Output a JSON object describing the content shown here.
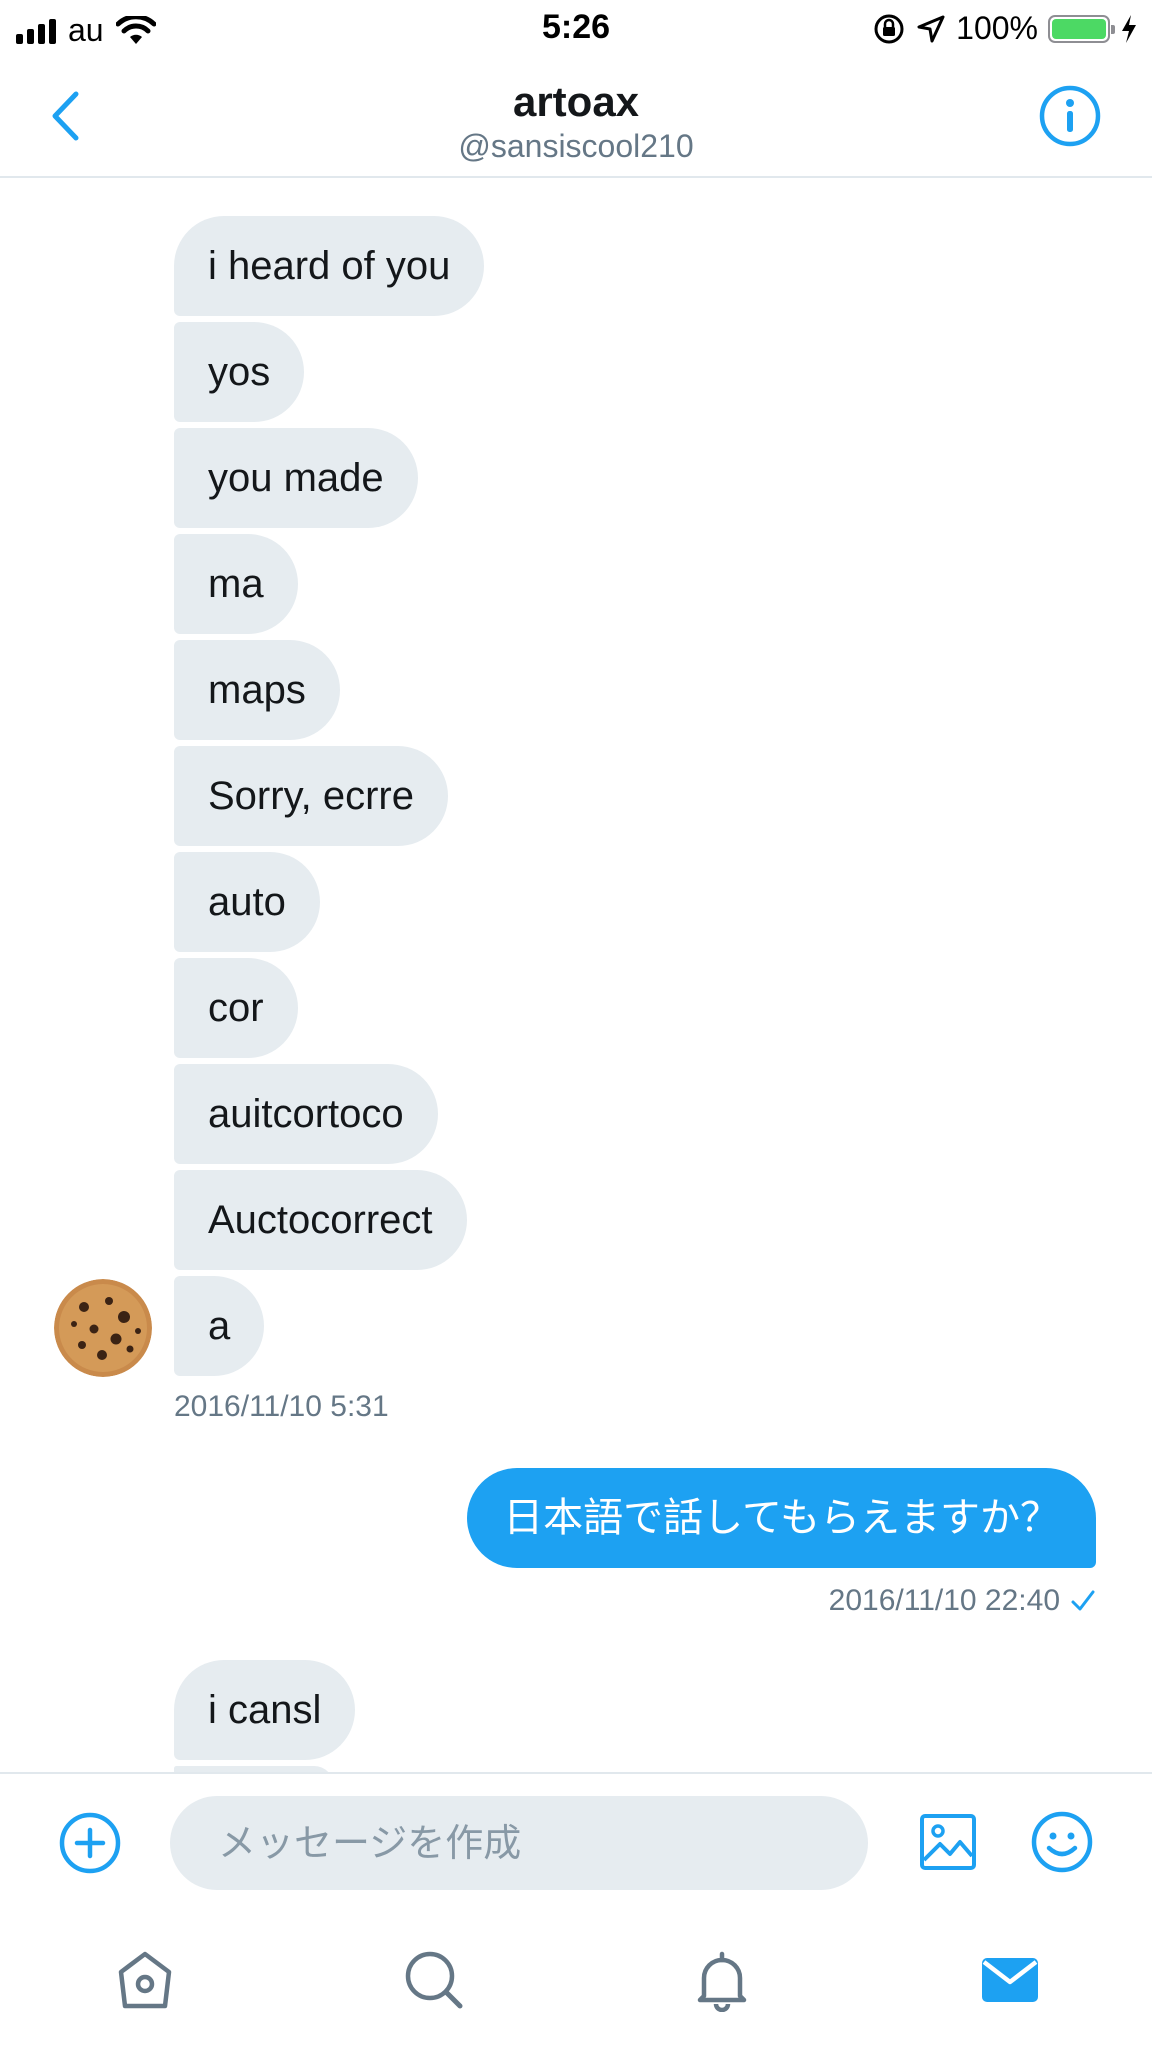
{
  "status_bar": {
    "carrier": "au",
    "time": "5:26",
    "battery": "100%"
  },
  "header": {
    "title": "artoax",
    "handle": "@sansiscool210"
  },
  "messages_in": [
    "i heard of you",
    "yos",
    "you made",
    "ma",
    "maps",
    "Sorry, ecrre",
    "auto",
    "cor",
    "auitcortoco",
    "Auctocorrect",
    "a"
  ],
  "timestamp_in": "2016/11/10 5:31",
  "message_out": "日本語で話してもらえますか？",
  "timestamp_out": "2016/11/10 22:40",
  "messages_in_2": [
    "i cansl"
  ],
  "composer": {
    "placeholder": "メッセージを作成"
  },
  "colors": {
    "accent": "#1da1f2",
    "bubble_in": "#e6ecf0",
    "muted": "#657786",
    "battery": "#4cd964"
  },
  "icons": [
    "back-chevron-icon",
    "info-icon",
    "add-icon",
    "image-icon",
    "emoji-icon",
    "home-icon",
    "search-icon",
    "notifications-icon",
    "messages-icon"
  ]
}
